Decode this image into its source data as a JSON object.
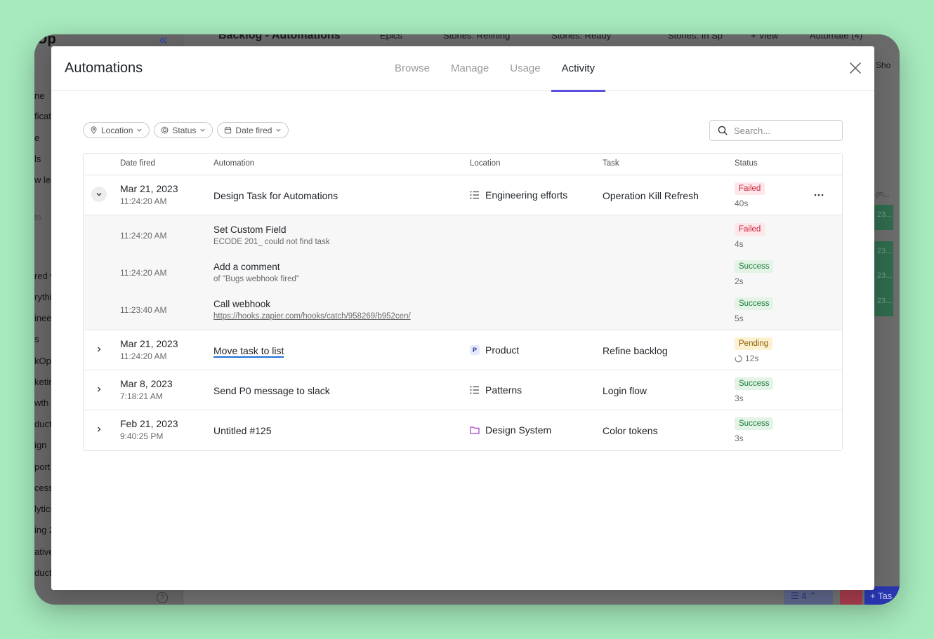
{
  "background_app": {
    "brand": "Up",
    "sidebar_items": [
      "ne",
      "ficat",
      "e",
      "ls",
      "w les",
      "ts",
      "red v",
      "rythi",
      "ineer",
      "s",
      "kOps",
      "ketin",
      "wth",
      "duct",
      "ign",
      "port",
      "cess",
      "lytics",
      "ing 2",
      "ative",
      "duct"
    ],
    "topbar": {
      "title": "Backlog - Automations",
      "tabs": [
        "Epics",
        "Stories: Refining",
        "Stories: Ready",
        "Stories: In Sp"
      ],
      "view_label": "+ View",
      "automate_label": "Automate (4)",
      "show_label": "Sho"
    },
    "right_column_header": "(Fi...",
    "right_cells": [
      "23...",
      "23...",
      "23...",
      "23..."
    ],
    "bottom_count": "4",
    "add_task_label": "+ Tas"
  },
  "modal": {
    "title": "Automations",
    "tabs": [
      {
        "label": "Browse",
        "active": false
      },
      {
        "label": "Manage",
        "active": false
      },
      {
        "label": "Usage",
        "active": false
      },
      {
        "label": "Activity",
        "active": true
      }
    ],
    "accent_color": "#5b4fe0"
  },
  "filters": {
    "location": "Location",
    "status": "Status",
    "date_fired": "Date fired"
  },
  "search": {
    "placeholder": "Search..."
  },
  "table": {
    "headers": {
      "date_fired": "Date fired",
      "automation": "Automation",
      "location": "Location",
      "task": "Task",
      "status": "Status"
    },
    "rows": [
      {
        "expanded": true,
        "date": "Mar 21, 2023",
        "time": "11:24:20 AM",
        "automation": "Design Task for Automations",
        "location": "Engineering efforts",
        "location_icon": "list-icon",
        "task": "Operation Kill Refresh",
        "status": "Failed",
        "duration": "40s",
        "children": [
          {
            "time": "11:24:20 AM",
            "name": "Set Custom Field",
            "desc": "ECODE 201_ could not find task",
            "status": "Failed",
            "duration": "4s"
          },
          {
            "time": "11:24:20 AM",
            "name": "Add a comment",
            "desc": "of \"Bugs webhook fired\"",
            "status": "Success",
            "duration": "2s"
          },
          {
            "time": "11:23:40 AM",
            "name": "Call webhook",
            "desc": "https://hooks.zapier.com/hooks/catch/958269/b952cen/",
            "status": "Success",
            "duration": "5s"
          }
        ]
      },
      {
        "expanded": false,
        "date": "Mar 21, 2023",
        "time": "11:24:20 AM",
        "automation": "Move task to list",
        "location": "Product",
        "location_icon": "product-badge-icon",
        "location_badge": "P",
        "task": "Refine backlog",
        "status": "Pending",
        "duration": "12s"
      },
      {
        "expanded": false,
        "date": "Mar 8, 2023",
        "time": "7:18:21 AM",
        "automation": "Send P0 message to slack",
        "location": "Patterns",
        "location_icon": "list-icon",
        "task": "Login flow",
        "status": "Success",
        "duration": "3s"
      },
      {
        "expanded": false,
        "date": "Feb 21, 2023",
        "time": "9:40:25 PM",
        "automation": "Untitled #125",
        "location": "Design System",
        "location_icon": "folder-icon",
        "task": "Color tokens",
        "status": "Success",
        "duration": "3s"
      }
    ]
  },
  "colors": {
    "failed": "#c8203b",
    "success": "#1e7a3c",
    "pending": "#8a5a00",
    "link": "#1f6fd6"
  }
}
